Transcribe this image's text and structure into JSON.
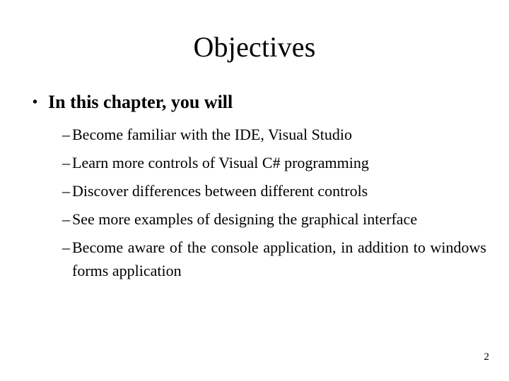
{
  "slide": {
    "title": "Objectives",
    "page_number": "2",
    "background_color": "#ffffff",
    "text_color": "#000000",
    "bullet_marker": "•",
    "dash_marker": "–",
    "level1": [
      {
        "text": "In this chapter, you will",
        "children": [
          {
            "text": "Become familiar with the IDE, Visual Studio",
            "justified": false
          },
          {
            "text": "Learn more controls of Visual C# programming",
            "justified": false
          },
          {
            "text": "Discover differences between different controls",
            "justified": false
          },
          {
            "text": "See more examples of designing the graphical interface",
            "justified": true
          },
          {
            "text": "Become aware of the console application, in addition to windows forms application",
            "justified": true
          }
        ]
      }
    ]
  }
}
